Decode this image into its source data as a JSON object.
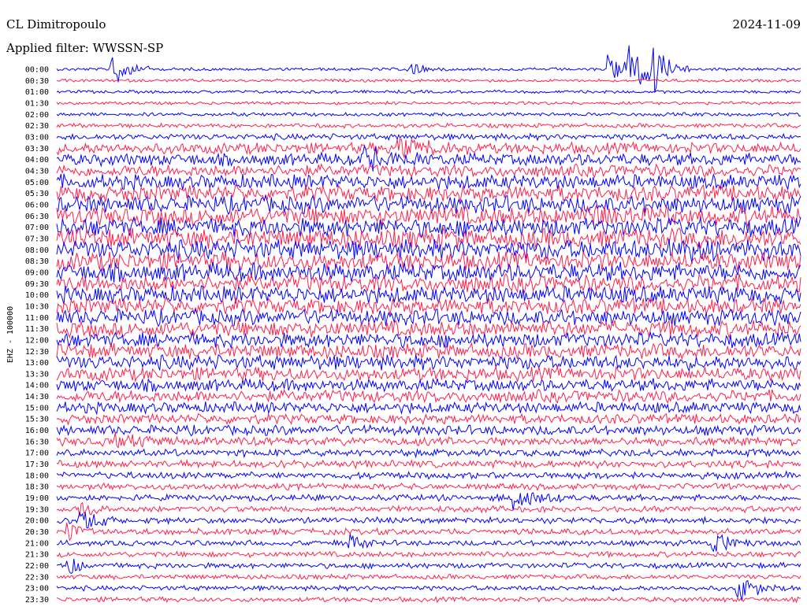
{
  "header": {
    "station": "CL Dimitropoulo",
    "filter": "Applied filter: WWSSN-SP",
    "date": "2024-11-09"
  },
  "chart_data": {
    "type": "line",
    "title": "CL Dimitropoulo",
    "subtitle": "Applied filter: WWSSN-SP",
    "date": "2024-11-09",
    "ylabel": "EHZ - 100000",
    "xlabel": "",
    "row_interval_minutes": 30,
    "row_labels": [
      "00:00",
      "00:30",
      "01:00",
      "01:30",
      "02:00",
      "02:30",
      "03:00",
      "03:30",
      "04:00",
      "04:30",
      "05:00",
      "05:30",
      "06:00",
      "06:30",
      "07:00",
      "07:30",
      "08:00",
      "08:30",
      "09:00",
      "09:30",
      "10:00",
      "10:30",
      "11:00",
      "11:30",
      "12:00",
      "12:30",
      "13:00",
      "13:30",
      "14:00",
      "14:30",
      "15:00",
      "15:30",
      "16:00",
      "16:30",
      "17:00",
      "17:30",
      "18:00",
      "18:30",
      "19:00",
      "19:30",
      "20:00",
      "20:30",
      "21:00",
      "21:30",
      "22:00",
      "22:30",
      "23:00",
      "23:30"
    ],
    "series_colors": [
      "#0000ff",
      "#ff1f4b"
    ],
    "noise_level": [
      0.25,
      0.25,
      0.25,
      0.25,
      0.3,
      0.35,
      0.5,
      0.9,
      1.0,
      1.0,
      1.2,
      1.3,
      1.4,
      1.5,
      1.5,
      1.6,
      1.6,
      1.5,
      1.5,
      1.4,
      1.4,
      1.3,
      1.3,
      1.3,
      1.2,
      1.2,
      1.2,
      1.1,
      1.0,
      1.0,
      0.9,
      0.8,
      0.8,
      0.7,
      0.6,
      0.6,
      0.55,
      0.5,
      0.5,
      0.5,
      0.5,
      0.5,
      0.45,
      0.45,
      0.45,
      0.4,
      0.4,
      0.4
    ],
    "events": [
      {
        "row": 0,
        "minute": 2.2,
        "amplitude": 4.0,
        "duration_min": 1.5
      },
      {
        "row": 0,
        "minute": 14.2,
        "amplitude": 2.0,
        "duration_min": 1.0
      },
      {
        "row": 0,
        "minute": 22.3,
        "amplitude": 3.5,
        "duration_min": 1.5
      },
      {
        "row": 0,
        "minute": 23.1,
        "amplitude": 6.0,
        "duration_min": 2.0
      },
      {
        "row": 0,
        "minute": 24.0,
        "amplitude": 4.0,
        "duration_min": 1.5
      },
      {
        "row": 7,
        "minute": 13.8,
        "amplitude": 1.6,
        "duration_min": 3.0
      },
      {
        "row": 8,
        "minute": 12.5,
        "amplitude": 1.8,
        "duration_min": 3.0
      },
      {
        "row": 13,
        "minute": 21.5,
        "amplitude": 1.5,
        "duration_min": 4.0
      },
      {
        "row": 16,
        "minute": 24.5,
        "amplitude": 1.5,
        "duration_min": 4.0
      },
      {
        "row": 33,
        "minute": 2.3,
        "amplitude": 1.5,
        "duration_min": 1.5
      },
      {
        "row": 38,
        "minute": 18.5,
        "amplitude": 3.0,
        "duration_min": 2.0
      },
      {
        "row": 39,
        "minute": 1.0,
        "amplitude": 2.0,
        "duration_min": 1.0
      },
      {
        "row": 40,
        "minute": 1.0,
        "amplitude": 2.5,
        "duration_min": 1.5
      },
      {
        "row": 41,
        "minute": 0.5,
        "amplitude": 2.5,
        "duration_min": 1.0
      },
      {
        "row": 42,
        "minute": 11.8,
        "amplitude": 2.0,
        "duration_min": 1.0
      },
      {
        "row": 42,
        "minute": 26.5,
        "amplitude": 2.5,
        "duration_min": 1.5
      },
      {
        "row": 44,
        "minute": 0.5,
        "amplitude": 2.0,
        "duration_min": 1.0
      },
      {
        "row": 46,
        "minute": 27.5,
        "amplitude": 3.0,
        "duration_min": 1.5
      }
    ]
  }
}
